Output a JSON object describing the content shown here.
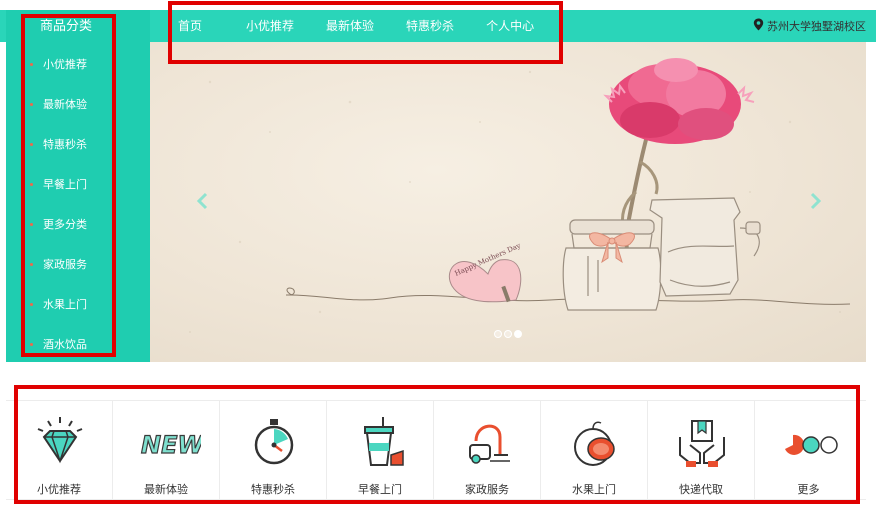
{
  "colors": {
    "brand": "#2ad5b9",
    "sidebar": "#1fcdb0",
    "highlight": "#e00000",
    "bullet": "#e96b4d"
  },
  "nav": {
    "links": [
      "首页",
      "小优推荐",
      "最新体验",
      "特惠秒杀",
      "个人中心"
    ],
    "location": "苏州大学独墅湖校区",
    "location_icon": "map-pin-icon"
  },
  "sidebar": {
    "title": "商品分类",
    "items": [
      "小优推荐",
      "最新体验",
      "特惠秒杀",
      "早餐上门",
      "更多分类",
      "家政服务",
      "水果上门",
      "酒水饮品"
    ]
  },
  "banner": {
    "image": "mothers-day-carnation-illustration",
    "card_text": "Happy Mothers Day",
    "slides_total": 3,
    "active_slide": 3
  },
  "categories": [
    {
      "label": "小优推荐",
      "icon": "diamond-icon"
    },
    {
      "label": "最新体验",
      "icon": "new-badge-icon"
    },
    {
      "label": "特惠秒杀",
      "icon": "stopwatch-icon"
    },
    {
      "label": "早餐上门",
      "icon": "coffee-cake-icon"
    },
    {
      "label": "家政服务",
      "icon": "vacuum-cleaner-icon"
    },
    {
      "label": "水果上门",
      "icon": "fruit-icon"
    },
    {
      "label": "快递代取",
      "icon": "parcel-hands-icon"
    },
    {
      "label": "更多",
      "icon": "more-dots-icon"
    }
  ]
}
